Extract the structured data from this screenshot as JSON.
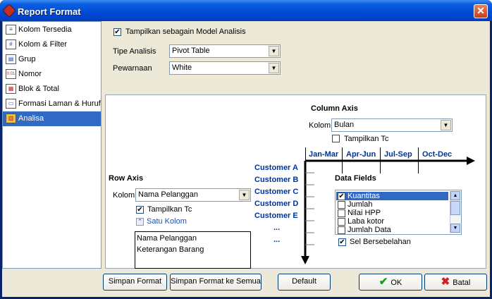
{
  "window": {
    "title": "Report Format",
    "close_label": "✕"
  },
  "sidebar": {
    "items": [
      {
        "label": "Kolom Tersedia",
        "icon": "columns-icon",
        "glyph": "≡"
      },
      {
        "label": "Kolom & Filter",
        "icon": "filter-icon",
        "glyph": "#"
      },
      {
        "label": "Grup",
        "icon": "group-icon",
        "glyph": "▤"
      },
      {
        "label": "Nomor",
        "icon": "number-icon",
        "glyph": "0.01"
      },
      {
        "label": "Blok & Total",
        "icon": "block-icon",
        "glyph": "▦"
      },
      {
        "label": "Formasi Laman & Huruf",
        "icon": "page-layout-icon",
        "glyph": "▭"
      },
      {
        "label": "Analisa",
        "icon": "analysis-icon",
        "glyph": "▥"
      }
    ]
  },
  "top": {
    "show_model_label": "Tampilkan sebagain Model Analisis",
    "show_model_checked": "✔",
    "type_label": "Tipe Analisis",
    "type_value": "Pivot Table",
    "color_label": "Pewarnaan",
    "color_value": "White"
  },
  "pivot": {
    "column_axis_title": "Column Axis",
    "column_label": "Kolom",
    "column_value": "Bulan",
    "column_show_label": "Tampilkan Tc",
    "column_show_checked": "",
    "months": [
      "Jan-Mar",
      "Apr-Jun",
      "Jul-Sep",
      "Oct-Dec"
    ],
    "row_axis_title": "Row Axis",
    "row_label": "Kolom",
    "row_value": "Nama Pelanggan",
    "row_show_label": "Tampilkan Tc",
    "row_show_checked": "✔",
    "single_column_label": "Satu Kolom",
    "row_columns": [
      "Nama Pelanggan",
      "Keterangan Barang"
    ],
    "customers": [
      "Customer A",
      "Customer B",
      "Customer C",
      "Customer D",
      "Customer E"
    ],
    "ellipsis": "...",
    "data_fields_title": "Data Fields",
    "data_fields": [
      {
        "label": "Kuantitas",
        "checked": "✔"
      },
      {
        "label": "Jumlah",
        "checked": ""
      },
      {
        "label": "Nilai HPP",
        "checked": ""
      },
      {
        "label": "Laba kotor",
        "checked": ""
      },
      {
        "label": "Jumlah Data",
        "checked": ""
      }
    ],
    "side_by_side_label": "Sel Bersebelahan",
    "side_by_side_checked": "✔"
  },
  "buttons": {
    "save_format": "Simpan Format",
    "save_format_all": "Simpan Format ke Semua",
    "default": "Default",
    "ok": "OK",
    "cancel": "Batal"
  },
  "colors": {
    "title_bar": "#0049d6",
    "selection": "#316ac5",
    "axis_text": "#003399",
    "face": "#ece9d8"
  }
}
